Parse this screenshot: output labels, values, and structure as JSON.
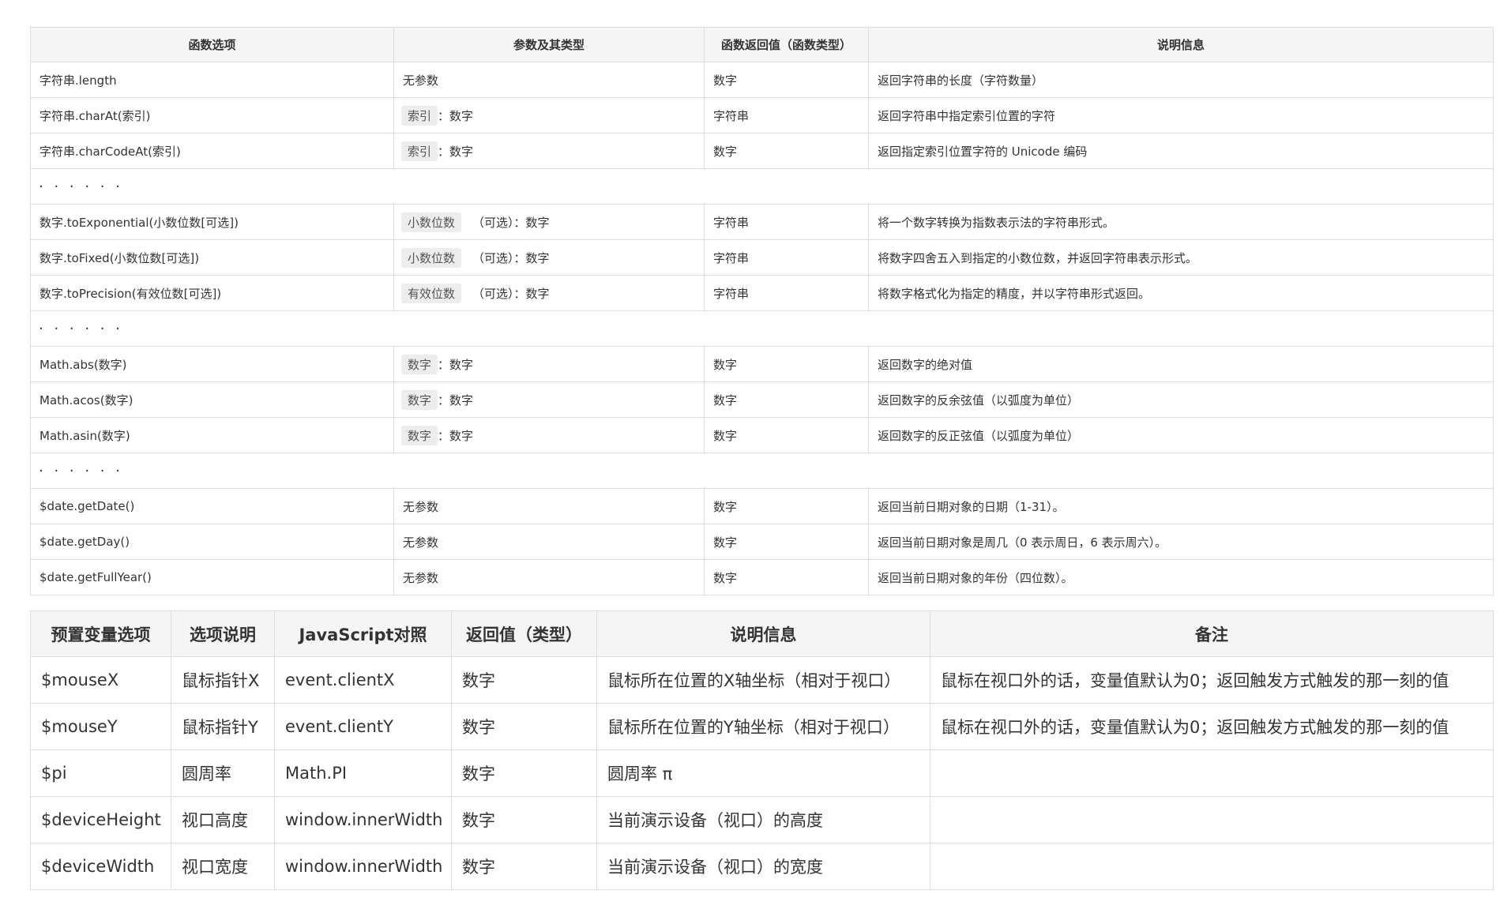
{
  "functions_table": {
    "headers": [
      "函数选项",
      "参数及其类型",
      "函数返回值（函数类型）",
      "说明信息"
    ],
    "rows": [
      {
        "fn": "字符串.length",
        "param_plain": "无参数",
        "ret": "数字",
        "desc": "返回字符串的长度（字符数量）"
      },
      {
        "fn": "字符串.charAt(索引)",
        "param_tag": "索引",
        "param_type": "：数字",
        "ret": "字符串",
        "desc": "返回字符串中指定索引位置的字符"
      },
      {
        "fn": "字符串.charCodeAt(索引)",
        "param_tag": "索引",
        "param_type": "：数字",
        "ret": "数字",
        "desc": "返回指定索引位置字符的 Unicode 编码"
      },
      {
        "ellipsis": "· · · · · ·"
      },
      {
        "fn": "数字.toExponential(小数位数[可选])",
        "param_tag": "小数位数",
        "param_opt": "（可选）",
        "param_type": "：数字",
        "ret": "字符串",
        "desc": "将一个数字转换为指数表示法的字符串形式。"
      },
      {
        "fn": "数字.toFixed(小数位数[可选])",
        "param_tag": "小数位数",
        "param_opt": "（可选）",
        "param_type": "：数字",
        "ret": "字符串",
        "desc": "将数字四舍五入到指定的小数位数，并返回字符串表示形式。"
      },
      {
        "fn": "数字.toPrecision(有效位数[可选])",
        "param_tag": "有效位数",
        "param_opt": "（可选）",
        "param_type": "：数字",
        "ret": "字符串",
        "desc": "将数字格式化为指定的精度，并以字符串形式返回。"
      },
      {
        "ellipsis": "· · · · · ·"
      },
      {
        "fn": "Math.abs(数字)",
        "param_tag": "数字",
        "param_type": "：数字",
        "ret": "数字",
        "desc": "返回数字的绝对值"
      },
      {
        "fn": "Math.acos(数字)",
        "param_tag": "数字",
        "param_type": "：数字",
        "ret": "数字",
        "desc": "返回数字的反余弦值（以弧度为单位）"
      },
      {
        "fn": "Math.asin(数字)",
        "param_tag": "数字",
        "param_type": "：数字",
        "ret": "数字",
        "desc": "返回数字的反正弦值（以弧度为单位）"
      },
      {
        "ellipsis": "· · · · · ·"
      },
      {
        "fn": "$date.getDate()",
        "param_plain": "无参数",
        "ret": "数字",
        "desc": "返回当前日期对象的日期（1-31）。"
      },
      {
        "fn": "$date.getDay()",
        "param_plain": "无参数",
        "ret": "数字",
        "desc": "返回当前日期对象是周几（0 表示周日，6 表示周六）。"
      },
      {
        "fn": "$date.getFullYear()",
        "param_plain": "无参数",
        "ret": "数字",
        "desc": "返回当前日期对象的年份（四位数）。"
      }
    ]
  },
  "variables_table": {
    "headers": [
      "预置变量选项",
      "选项说明",
      "JavaScript对照",
      "返回值（类型）",
      "说明信息",
      "备注"
    ],
    "rows": [
      {
        "var": "$mouseX",
        "label": "鼠标指针X",
        "js": "event.clientX",
        "ret": "数字",
        "desc": "鼠标所在位置的X轴坐标（相对于视口）",
        "note": "鼠标在视口外的话，变量值默认为0；返回触发方式触发的那一刻的值"
      },
      {
        "var": "$mouseY",
        "label": "鼠标指针Y",
        "js": "event.clientY",
        "ret": "数字",
        "desc": "鼠标所在位置的Y轴坐标（相对于视口）",
        "note": "鼠标在视口外的话，变量值默认为0；返回触发方式触发的那一刻的值"
      },
      {
        "var": "$pi",
        "label": "圆周率",
        "js": "Math.PI",
        "ret": "数字",
        "desc": "圆周率 π",
        "note": ""
      },
      {
        "var": "$deviceHeight",
        "label": "视口高度",
        "js": "window.innerWidth",
        "ret": "数字",
        "desc": "当前演示设备（视口）的高度",
        "note": ""
      },
      {
        "var": "$deviceWidth",
        "label": "视口宽度",
        "js": "window.innerWidth",
        "ret": "数字",
        "desc": "当前演示设备（视口）的宽度",
        "note": ""
      }
    ]
  }
}
